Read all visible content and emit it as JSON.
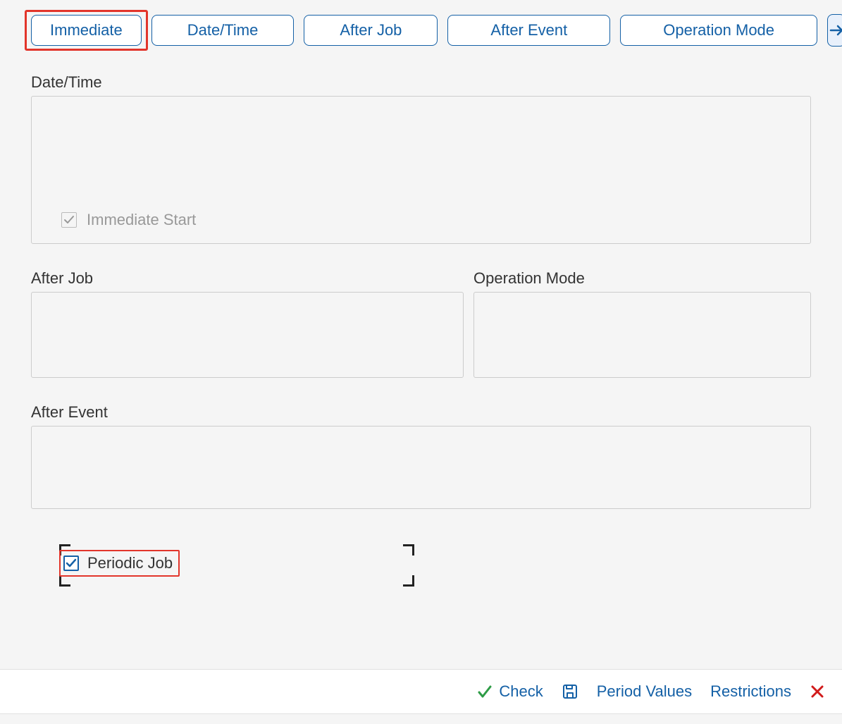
{
  "tabs": {
    "immediate": "Immediate",
    "datetime": "Date/Time",
    "afterjob": "After Job",
    "afterevent": "After Event",
    "opmode": "Operation Mode"
  },
  "sections": {
    "datetime_title": "Date/Time",
    "immediate_start_label": "Immediate Start",
    "afterjob_title": "After Job",
    "opmode_title": "Operation Mode",
    "afterevent_title": "After Event",
    "periodic_label": "Periodic Job"
  },
  "footer": {
    "check": "Check",
    "period_values": "Period Values",
    "restrictions": "Restrictions"
  }
}
